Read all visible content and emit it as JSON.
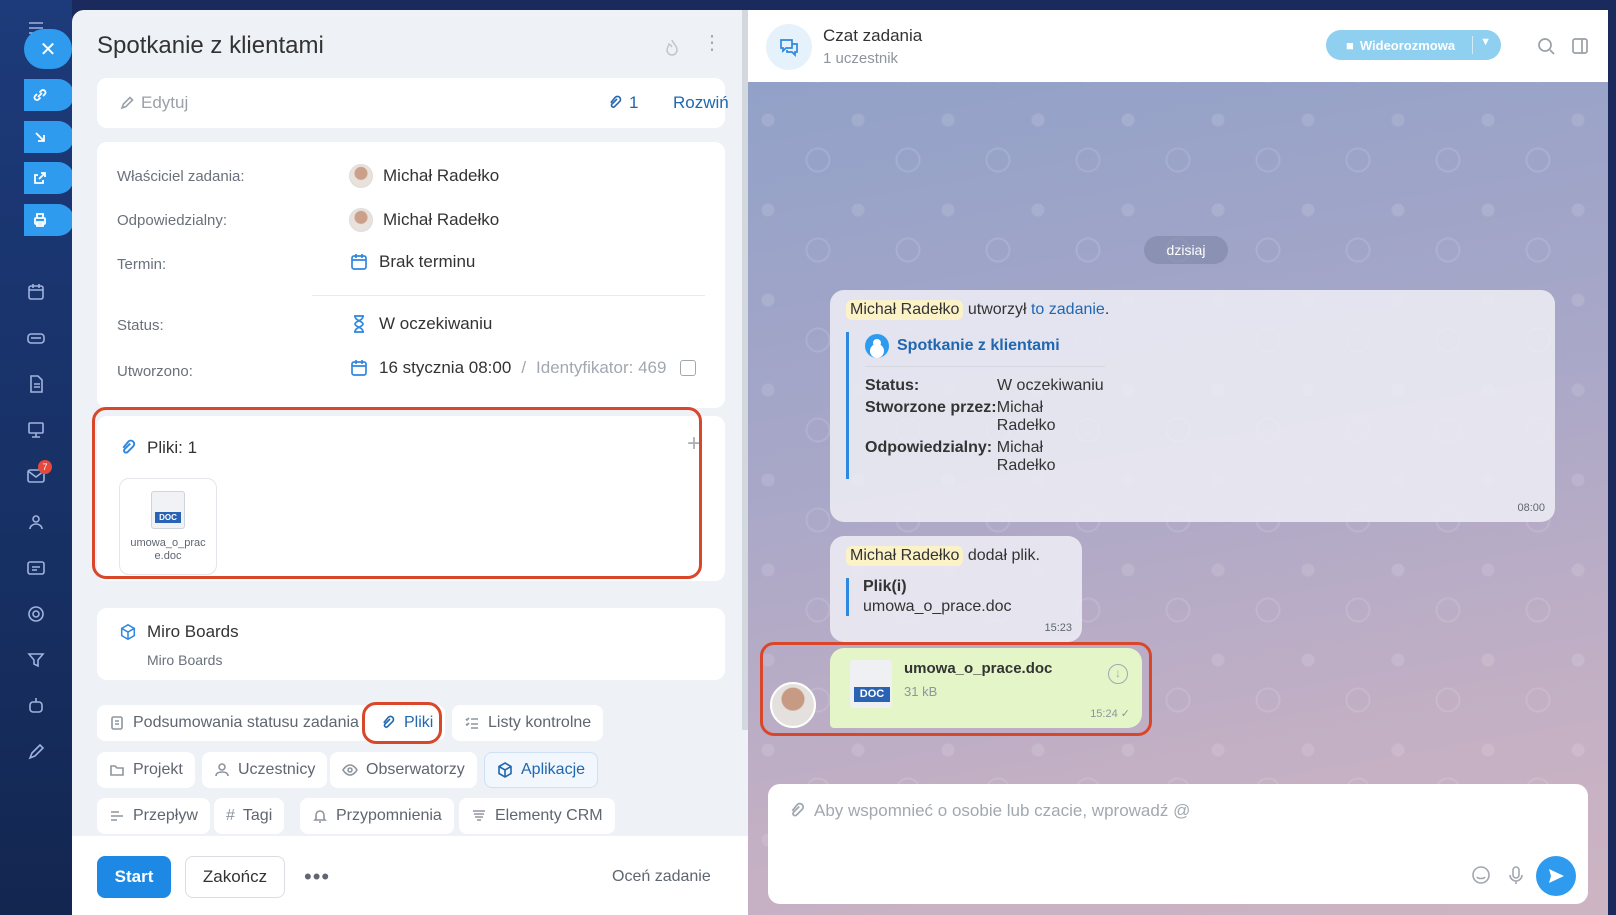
{
  "task": {
    "title": "Spotkanie z klientami",
    "edit_label": "Edytuj",
    "attachment_count": "1",
    "expand_label": "Rozwiń",
    "owner_label": "Właściciel zadania:",
    "owner_name": "Michał Radełko",
    "responsible_label": "Odpowiedzialny:",
    "responsible_name": "Michał Radełko",
    "deadline_label": "Termin:",
    "deadline_value": "Brak terminu",
    "status_label": "Status:",
    "status_value": "W oczekiwaniu",
    "created_label": "Utworzono:",
    "created_value": "16 stycznia 08:00",
    "id_sep": "/",
    "id_value": "Identyfikator: 469",
    "files_title": "Pliki: 1",
    "file_name": "umowa_o_prace.doc",
    "file_badge": "DOC",
    "miro_title": "Miro Boards",
    "miro_sub": "Miro Boards",
    "chips": [
      "Podsumowania statusu zadania",
      "Pliki",
      "Listy kontrolne",
      "Projekt",
      "Uczestnicy",
      "Obserwatorzy",
      "Aplikacje",
      "Przepływ",
      "Tagi",
      "Przypomnienia",
      "Elementy CRM"
    ],
    "start_label": "Start",
    "finish_label": "Zakończ",
    "more_label": "•••",
    "rate_label": "Oceń zadanie"
  },
  "rail": {
    "mail_badge": "7"
  },
  "chat": {
    "title": "Czat zadania",
    "subtitle": "1 uczestnik",
    "video_label": "Wideorozmowa",
    "date_label": "dzisiaj",
    "sys_author": "Michał Radełko",
    "sys_text": "utworzył",
    "sys_link": "to zadanie",
    "sys_period": ".",
    "quote_title": "Spotkanie z klientami",
    "quote_rows": [
      {
        "k": "Status:",
        "v": "W oczekiwaniu"
      },
      {
        "k": "Stworzone przez:",
        "v": "Michał Radełko"
      },
      {
        "k": "Odpowiedzialny:",
        "v": "Michał Radełko"
      }
    ],
    "sys_time": "08:00",
    "file_author": "Michał Radełko",
    "file_text": "dodał plik.",
    "file_quote_title": "Plik(i)",
    "file_quote_value": "umowa_o_prace.doc",
    "file_time": "15:23",
    "doc_badge": "DOC",
    "doc_name": "umowa_o_prace.doc",
    "doc_size": "31 kB",
    "doc_time": "15:24 ✓",
    "input_placeholder": "Aby wspomnieć o osobie lub czacie, wprowadź @"
  }
}
